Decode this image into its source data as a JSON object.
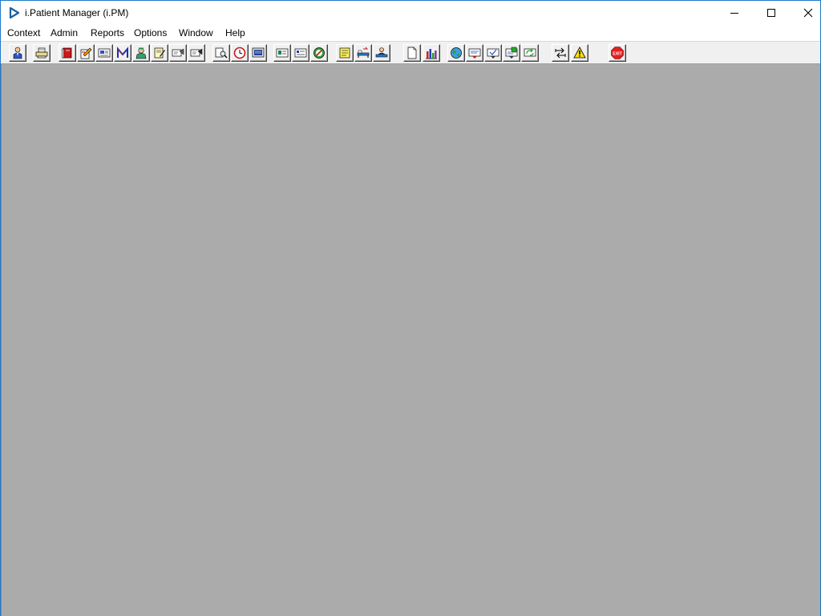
{
  "window": {
    "title": "i.Patient Manager (i.PM)",
    "title_icon": "play-triangle-icon",
    "controls": [
      "minimize",
      "maximize",
      "close"
    ]
  },
  "menu": [
    "Context",
    "Admin",
    "Reports",
    "Options",
    "Window",
    "Help"
  ],
  "toolbar": {
    "buttons": [
      {
        "icon": "patient-person-icon"
      },
      {
        "icon": "printer-icon"
      },
      {
        "icon": "red-book-icon"
      },
      {
        "icon": "edit-document-icon"
      },
      {
        "icon": "form-view-icon"
      },
      {
        "icon": "m-letter-icon"
      },
      {
        "icon": "doctor-icon"
      },
      {
        "icon": "notepad-icon"
      },
      {
        "icon": "referral-card-icon"
      },
      {
        "icon": "referral-card-alt-icon"
      },
      {
        "icon": "search-document-icon"
      },
      {
        "icon": "clock-icon"
      },
      {
        "icon": "monitor-list-icon"
      },
      {
        "icon": "id-card-icon"
      },
      {
        "icon": "card-list-icon"
      },
      {
        "icon": "no-entry-icon"
      },
      {
        "icon": "yellow-note-icon"
      },
      {
        "icon": "bed-transfer-icon"
      },
      {
        "icon": "person-bed-icon"
      },
      {
        "icon": "blank-page-icon"
      },
      {
        "icon": "bar-chart-icon"
      },
      {
        "icon": "globe-icon"
      },
      {
        "icon": "message-in-icon"
      },
      {
        "icon": "message-check-icon"
      },
      {
        "icon": "message-green-icon"
      },
      {
        "icon": "message-refresh-icon"
      },
      {
        "icon": "swap-arrows-icon"
      },
      {
        "icon": "warning-icon"
      },
      {
        "icon": "exit-stop-icon",
        "label": "EXIT"
      }
    ]
  },
  "colors": {
    "workspace": "#ababab",
    "toolbar": "#f0f0f0",
    "window_border": "#1e79c9",
    "exit_red": "#e02020"
  }
}
